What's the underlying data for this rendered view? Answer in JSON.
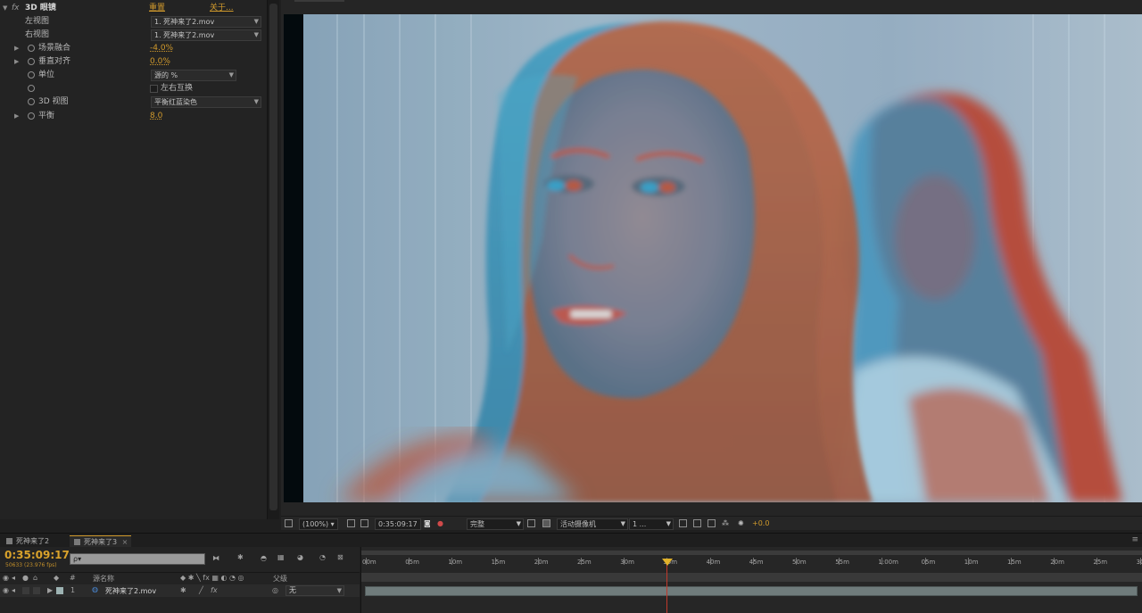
{
  "effect_controls": {
    "fx_label": "fx",
    "effect_name": "3D 眼镜",
    "reset": "重置",
    "about": "关于...",
    "left_view": {
      "label": "左视图",
      "value": "1. 死神来了2.mov"
    },
    "right_view": {
      "label": "右视图",
      "value": "1. 死神来了2.mov"
    },
    "scene_convergence": {
      "label": "场景融合",
      "value": "-4.0%"
    },
    "vertical_align": {
      "label": "垂直对齐",
      "value": "0.0%"
    },
    "units": {
      "label": "单位",
      "value": "源的 %"
    },
    "swap": {
      "label": "左右互换"
    },
    "view_3d": {
      "label": "3D 视图",
      "value": "平衡红蓝染色"
    },
    "balance": {
      "label": "平衡",
      "value": "8.0"
    }
  },
  "viewer": {
    "zoom": "(100%)",
    "timecode": "0:35:09:17",
    "resolution": "完整",
    "camera": "活动摄像机",
    "views": "1 ...",
    "exposure": "+0.0"
  },
  "timeline": {
    "tabs": [
      {
        "label": "死神来了2"
      },
      {
        "label": "死神来了3"
      }
    ],
    "current_time": "0:35:09:17",
    "frame_info": "50633 (23.976 fps)",
    "search_placeholder": "ρ▾",
    "col_source": "源名称",
    "col_parent": "父级",
    "hash": "#",
    "layer": {
      "index": "1",
      "name": "死神来了2.mov",
      "parent": "无"
    },
    "ruler": [
      "00m",
      "05m",
      "10m",
      "15m",
      "20m",
      "25m",
      "30m",
      "35m",
      "40m",
      "45m",
      "50m",
      "55m",
      "1:00m",
      "05m",
      "10m",
      "15m",
      "20m",
      "25m",
      "30m"
    ]
  },
  "colors": {
    "accent": "#d19a2c",
    "playhead": "#e0b12a",
    "layer_bar": "#6f7b7b"
  }
}
